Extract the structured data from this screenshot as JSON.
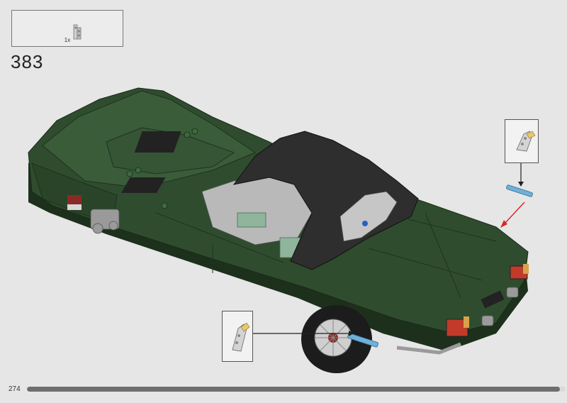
{
  "parts_list": {
    "quantity": "1x",
    "part_icon": "axle-connector-piece-icon"
  },
  "step": {
    "number": "383"
  },
  "callouts": [
    {
      "icon": "axle-connector-piece-icon"
    },
    {
      "icon": "axle-connector-piece-icon"
    }
  ],
  "model": {
    "icon": "green-convertible-sports-car-model"
  },
  "footer": {
    "page_number": "274",
    "progress": 0.99
  },
  "colors": {
    "background": "#e6e6e6",
    "car_green": "#2d4a2c",
    "soft_top": "#2e2e2e",
    "blue_axle": "#6fb0d8",
    "arrow_red": "#d42a2a"
  }
}
